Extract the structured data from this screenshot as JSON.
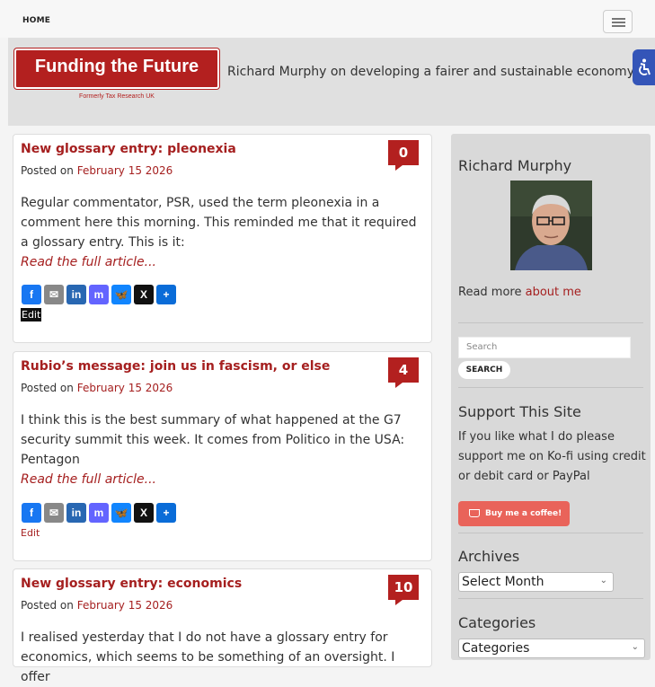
{
  "nav": {
    "home_label": "HOME"
  },
  "header": {
    "logo_title": "Funding the Future",
    "logo_subtitle": "Formerly Tax Research UK",
    "tagline": "Richard Murphy on developing a fairer and sustainable economy"
  },
  "posts": [
    {
      "title": "New glossary entry: pleonexia",
      "posted_on": "Posted on",
      "date": "February 15 2026",
      "comments": "0",
      "excerpt": "Regular commentator, PSR, used the term pleonexia in a comment here this morning. This reminded me that it required a glossary entry. This is it:",
      "read_more": "Read the full article...",
      "edit": "Edit"
    },
    {
      "title": "Rubio’s message: join us in fascism, or else",
      "posted_on": "Posted on",
      "date": "February 15 2026",
      "comments": "4",
      "excerpt": "I think this is the best summary of what happened at the G7 security summit this week. It comes from Politico in the USA: Pentagon",
      "read_more": "Read the full article...",
      "edit": "Edit"
    },
    {
      "title": "New glossary entry: economics",
      "posted_on": "Posted on",
      "date": "February 15 2026",
      "comments": "10",
      "excerpt": "I realised yesterday that I do not have a glossary entry for economics, which seems to be something of an oversight. I offer"
    }
  ],
  "share_icons": [
    {
      "name": "facebook-icon",
      "glyph": "f",
      "color": "#1877f2"
    },
    {
      "name": "email-icon",
      "glyph": "✉",
      "color": "#888888"
    },
    {
      "name": "linkedin-icon",
      "glyph": "in",
      "color": "#2867b2"
    },
    {
      "name": "mastodon-icon",
      "glyph": "m",
      "color": "#6364ff"
    },
    {
      "name": "bluesky-icon",
      "glyph": "🦋",
      "color": "#1185fe"
    },
    {
      "name": "x-icon",
      "glyph": "X",
      "color": "#111111"
    },
    {
      "name": "share-plus-icon",
      "glyph": "+",
      "color": "#0a6cd8"
    }
  ],
  "sidebar": {
    "author_heading": "Richard Murphy",
    "read_more_prefix": "Read more ",
    "read_more_link": "about me",
    "search_placeholder": "Search",
    "search_button": "SEARCH",
    "support_heading": "Support This Site",
    "support_text": "If you like what I do please support me on Ko-fi using credit or debit card or PayPal",
    "kofi_button": "Buy me a coffee!",
    "archives_heading": "Archives",
    "archives_select": "Select Month",
    "categories_heading": "Categories",
    "categories_select": "Categories"
  },
  "colors": {
    "brand_red": "#b3201f",
    "accessibility_blue": "#3455b8",
    "kofi": "#e9635a"
  }
}
